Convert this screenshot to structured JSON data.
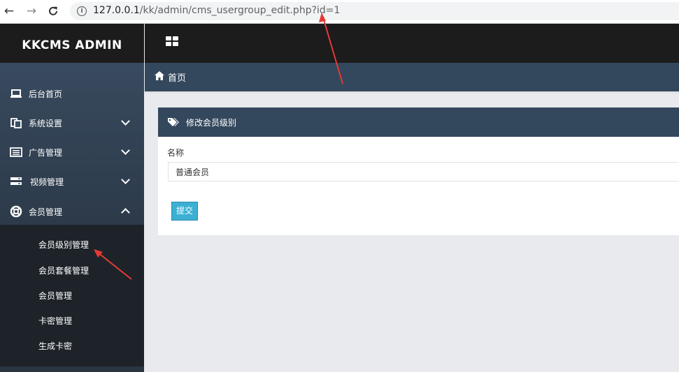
{
  "browser": {
    "url_host": "127.0.0.1",
    "url_path": "/kk/admin/cms_usergroup_edit.php?id=1",
    "back_icon": "arrow-left-icon",
    "forward_icon": "arrow-right-icon",
    "reload_icon": "reload-icon",
    "info_icon": "info-icon"
  },
  "brand": "KKCMS ADMIN",
  "sidebar": {
    "items": [
      {
        "label": "后台首页",
        "icon": "laptop-icon"
      },
      {
        "label": "系统设置",
        "icon": "copy-icon"
      },
      {
        "label": "广告管理",
        "icon": "list-icon"
      },
      {
        "label": "视频管理",
        "icon": "server-icon"
      },
      {
        "label": "会员管理",
        "icon": "lifebuoy-icon"
      }
    ],
    "subitems": [
      {
        "label": "会员级别管理"
      },
      {
        "label": "会员套餐管理"
      },
      {
        "label": "会员管理"
      },
      {
        "label": "卡密管理"
      },
      {
        "label": "生成卡密"
      }
    ]
  },
  "topbar": {
    "menu_icon": "grid-icon"
  },
  "breadcrumb": {
    "home_label": "首页",
    "icon": "home-icon"
  },
  "panel": {
    "title": "修改会员级别",
    "icon": "tags-icon",
    "field_label": "名称",
    "field_value": "普通会员",
    "submit_label": "提交"
  },
  "colors": {
    "sidebar_top": "#3b4e63",
    "header_dark": "#1c1c1c",
    "panel_head": "#34485d",
    "submit": "#3bb0d3",
    "annotation": "#e53935"
  }
}
